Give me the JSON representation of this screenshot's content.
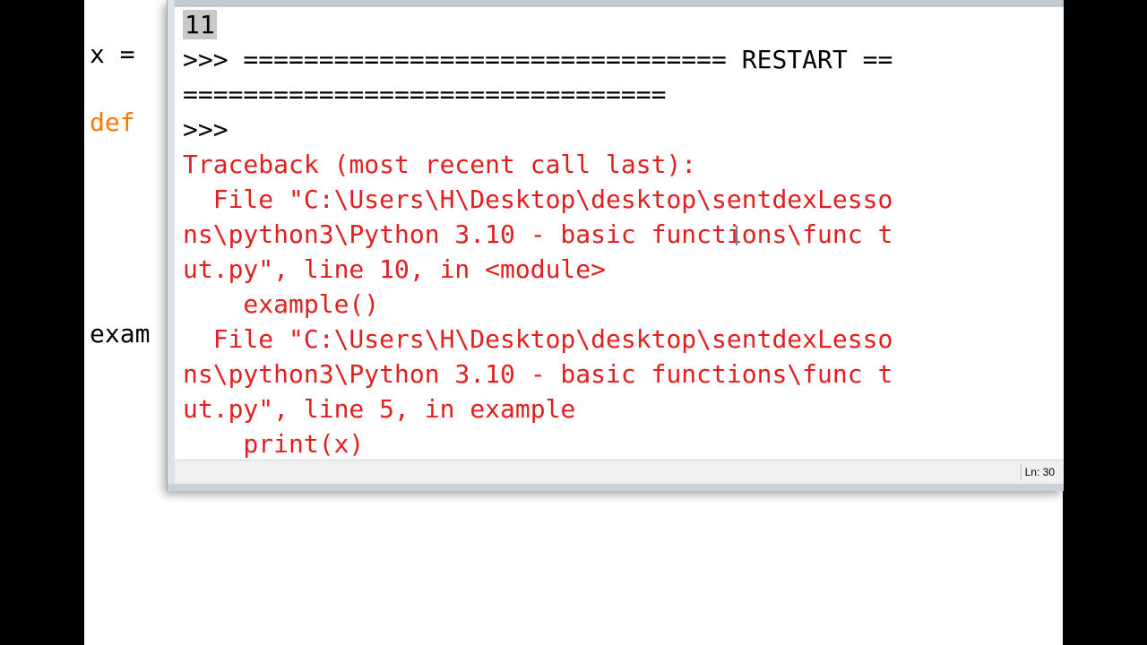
{
  "editor": {
    "line_x": "x =",
    "line_def": "def",
    "line_exam": "exam"
  },
  "shell": {
    "lines": [
      {
        "text": "11",
        "kind": "output-selected"
      },
      {
        "text": ">>> ================================ RESTART ==",
        "kind": "restart"
      },
      {
        "text": "================================",
        "kind": "restart"
      },
      {
        "text": ">>> ",
        "kind": "prompt"
      },
      {
        "text": "Traceback (most recent call last):",
        "kind": "error"
      },
      {
        "text": "  File \"C:\\Users\\H\\Desktop\\desktop\\sentdexLesso",
        "kind": "error"
      },
      {
        "text": "ns\\python3\\Python 3.10 - basic functions\\func t",
        "kind": "error"
      },
      {
        "text": "ut.py\", line 10, in <module>",
        "kind": "error"
      },
      {
        "text": "    example()",
        "kind": "error"
      },
      {
        "text": "  File \"C:\\Users\\H\\Desktop\\desktop\\sentdexLesso",
        "kind": "error"
      },
      {
        "text": "ns\\python3\\Python 3.10 - basic functions\\func t",
        "kind": "error"
      },
      {
        "text": "ut.py\", line 5, in example",
        "kind": "error"
      },
      {
        "text": "    print(x)",
        "kind": "error"
      }
    ]
  },
  "status": {
    "line_col": "Ln: 30"
  },
  "colors": {
    "error": "#e02020",
    "keyword": "#ff7700",
    "selection": "#c8c8c8"
  }
}
